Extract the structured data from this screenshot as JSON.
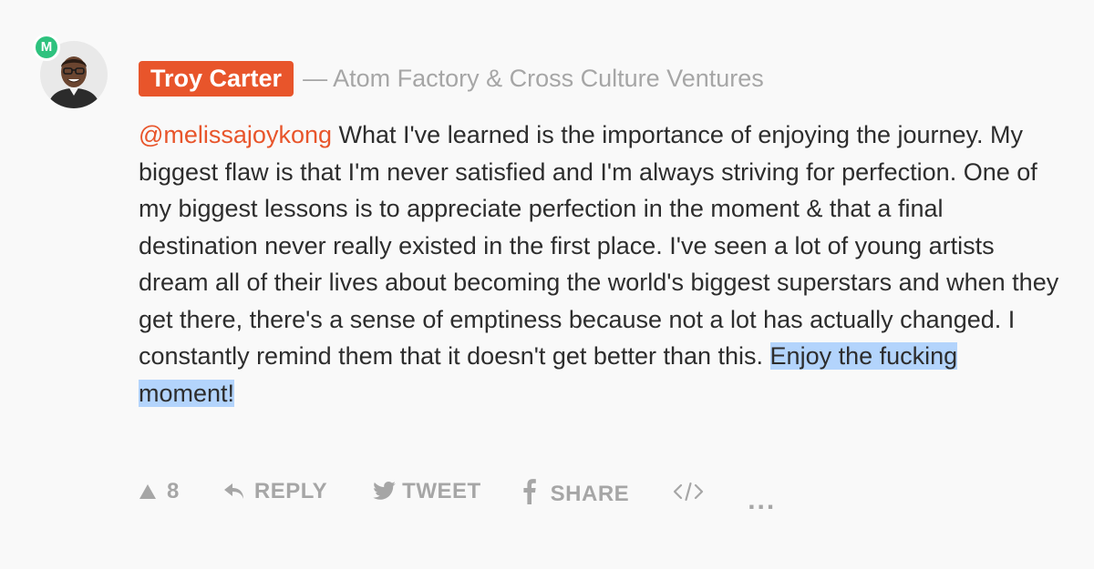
{
  "avatar": {
    "badge_letter": "M",
    "badge_color": "#2ec27e"
  },
  "author": {
    "name": "Troy Carter",
    "headline": "— Atom Factory & Cross Culture Ventures",
    "name_tag_color": "#e8552b"
  },
  "comment": {
    "mention": "@melissajoykong",
    "text": " What I've learned is the importance of enjoying the journey. My biggest flaw is that I'm never satisfied and I'm always striving for perfection. One of my biggest lessons is to appreciate perfection in the moment & that a final destination never really existed in the first place. I've seen a lot of young artists dream all of their lives about becoming the world's biggest superstars and when they get there, there's a sense of emptiness because not a lot has actually changed. I constantly remind them that it doesn't get better than this. ",
    "highlighted_text": "Enjoy the fucking moment!",
    "highlight_color": "#b3d4fc"
  },
  "actions": {
    "upvote": {
      "icon": "triangle-up-icon",
      "count": "8"
    },
    "reply": {
      "icon": "reply-arrow-icon",
      "label": "REPLY"
    },
    "tweet": {
      "icon": "twitter-bird-icon",
      "label": "TWEET"
    },
    "share": {
      "icon": "facebook-f-icon",
      "label": "SHARE"
    },
    "embed": {
      "icon": "code-icon"
    },
    "more": {
      "icon": "ellipsis-icon",
      "label": "..."
    }
  }
}
